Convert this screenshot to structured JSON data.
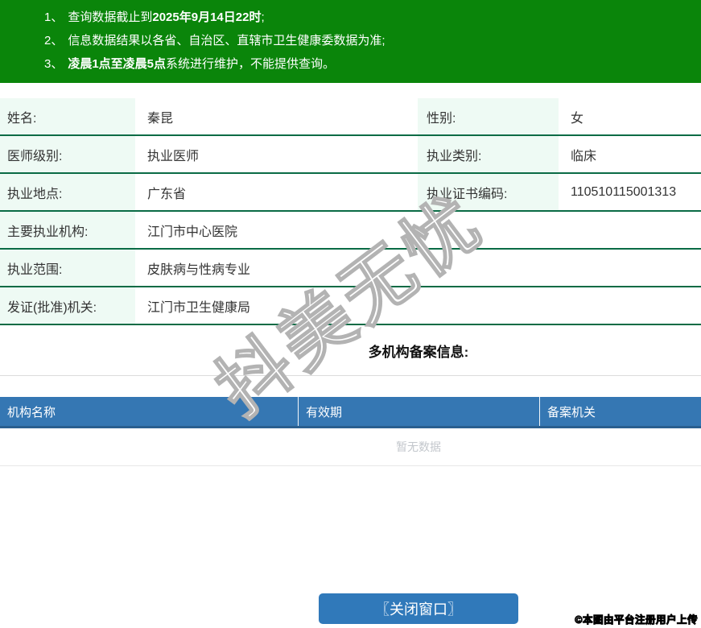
{
  "notice": {
    "lines": [
      {
        "num": "1、",
        "pre": "查询数据截止到",
        "bold": "2025年9月14日22时",
        "post": ";"
      },
      {
        "num": "2、",
        "pre": "信息数据结果以各省、自治区、直辖市卫生健康委数据为准;",
        "bold": "",
        "post": ""
      },
      {
        "num": "3、",
        "pre": "",
        "bold": "凌晨1点至凌晨5点",
        "post": "系统进行维护，不能提供查询。"
      }
    ]
  },
  "info": {
    "rows": [
      {
        "cells": [
          {
            "label": "姓名:",
            "value": "秦昆"
          },
          {
            "label": "性别:",
            "value": "女"
          }
        ]
      },
      {
        "cells": [
          {
            "label": "医师级别:",
            "value": "执业医师"
          },
          {
            "label": "执业类别:",
            "value": "临床"
          }
        ]
      },
      {
        "cells": [
          {
            "label": "执业地点:",
            "value": "广东省"
          },
          {
            "label": "执业证书编码:",
            "value": "110510115001313"
          }
        ]
      },
      {
        "cells": [
          {
            "label": "主要执业机构:",
            "value": "江门市中心医院"
          }
        ]
      },
      {
        "cells": [
          {
            "label": "执业范围:",
            "value": "皮肤病与性病专业"
          }
        ]
      },
      {
        "cells": [
          {
            "label": "发证(批准)机关:",
            "value": "江门市卫生健康局"
          }
        ]
      }
    ]
  },
  "filing_section": {
    "title": "多机构备案信息:",
    "headers": [
      "机构名称",
      "有效期",
      "备案机关"
    ],
    "empty_text": "暂无数据"
  },
  "actions": {
    "close_label": "〖关闭窗口〗"
  },
  "overlays": {
    "watermark_text": "抖美无忧",
    "copyright_text": "©本图由平台注册用户上传"
  },
  "colors": {
    "banner_green": "#0a850a",
    "divider_green": "#0a6b45",
    "label_cell_bg": "#eefaf4",
    "grid_header_blue": "#3577b3",
    "grid_header_border": "#2a5f8f",
    "button_blue": "#3079ba",
    "empty_text_gray": "#c3c7cc"
  }
}
